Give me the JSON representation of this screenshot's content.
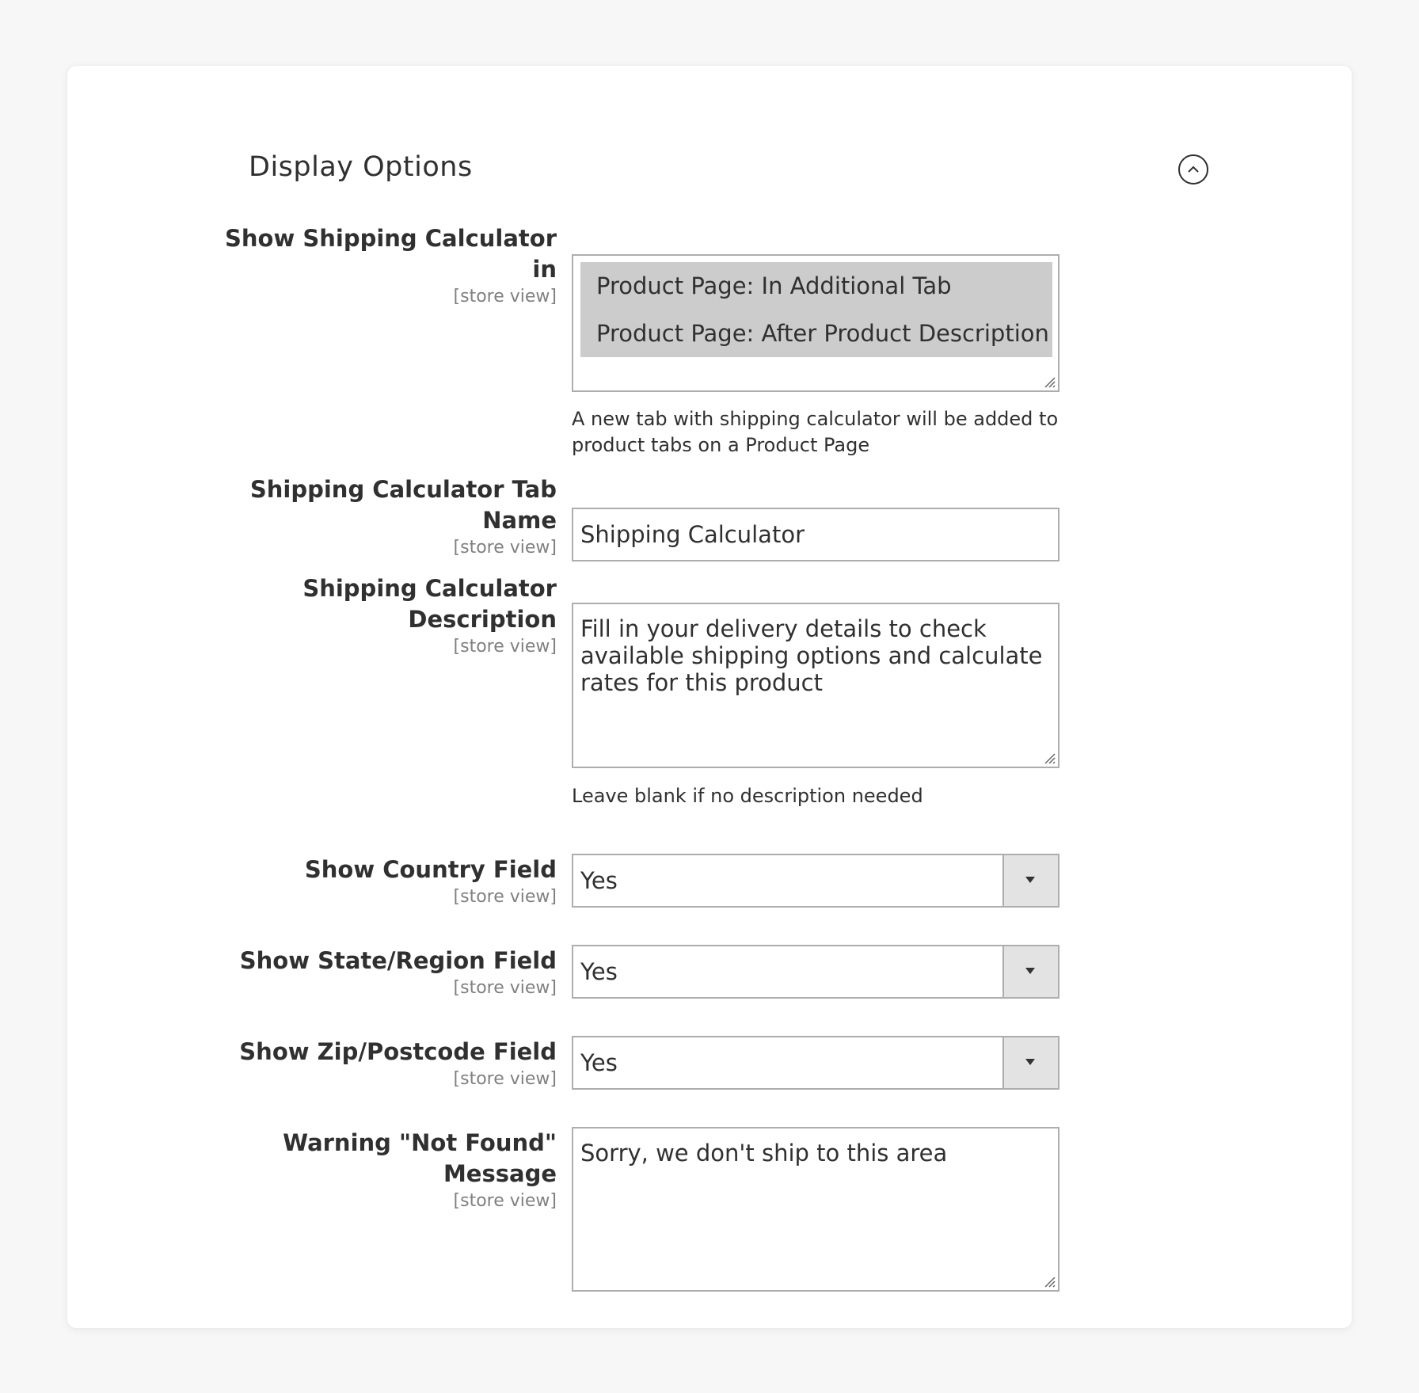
{
  "section": {
    "title": "Display Options"
  },
  "fields": {
    "show_calculator_in": {
      "label_line1": "Show Shipping Calculator",
      "label_line2": "in",
      "scope": "[store view]",
      "options": [
        "Product Page: In Additional Tab",
        "Product Page: After Product Description"
      ],
      "note_line1": "A new tab with shipping calculator will be added to",
      "note_line2": "product tabs on a Product Page"
    },
    "tab_name": {
      "label_line1": "Shipping Calculator Tab",
      "label_line2": "Name",
      "scope": "[store view]",
      "value": "Shipping Calculator"
    },
    "description": {
      "label_line1": "Shipping Calculator",
      "label_line2": "Description",
      "scope": "[store view]",
      "value_line1": "Fill in your delivery details to check",
      "value_line2": "available shipping options and calculate",
      "value_line3": "rates for this product",
      "note": "Leave blank if no description needed"
    },
    "show_country": {
      "label": "Show Country Field",
      "scope": "[store view]",
      "value": "Yes"
    },
    "show_region": {
      "label": "Show State/Region Field",
      "scope": "[store view]",
      "value": "Yes"
    },
    "show_zip": {
      "label": "Show Zip/Postcode Field",
      "scope": "[store view]",
      "value": "Yes"
    },
    "warning_message": {
      "label_line1": "Warning \"Not Found\"",
      "label_line2": "Message",
      "scope": "[store view]",
      "value": "Sorry, we don't ship to this area"
    }
  },
  "icons": {
    "collapse": "chevron-up-circle-icon",
    "select_arrow": "caret-down-icon",
    "resize": "resize-grip-icon"
  },
  "colors": {
    "page_bg": "#f7f7f7",
    "card_bg": "#ffffff",
    "text": "#303030",
    "muted": "#808080",
    "border": "#adadad",
    "selected_option_bg": "#cccccc",
    "select_button_bg": "#e3e3e3"
  }
}
